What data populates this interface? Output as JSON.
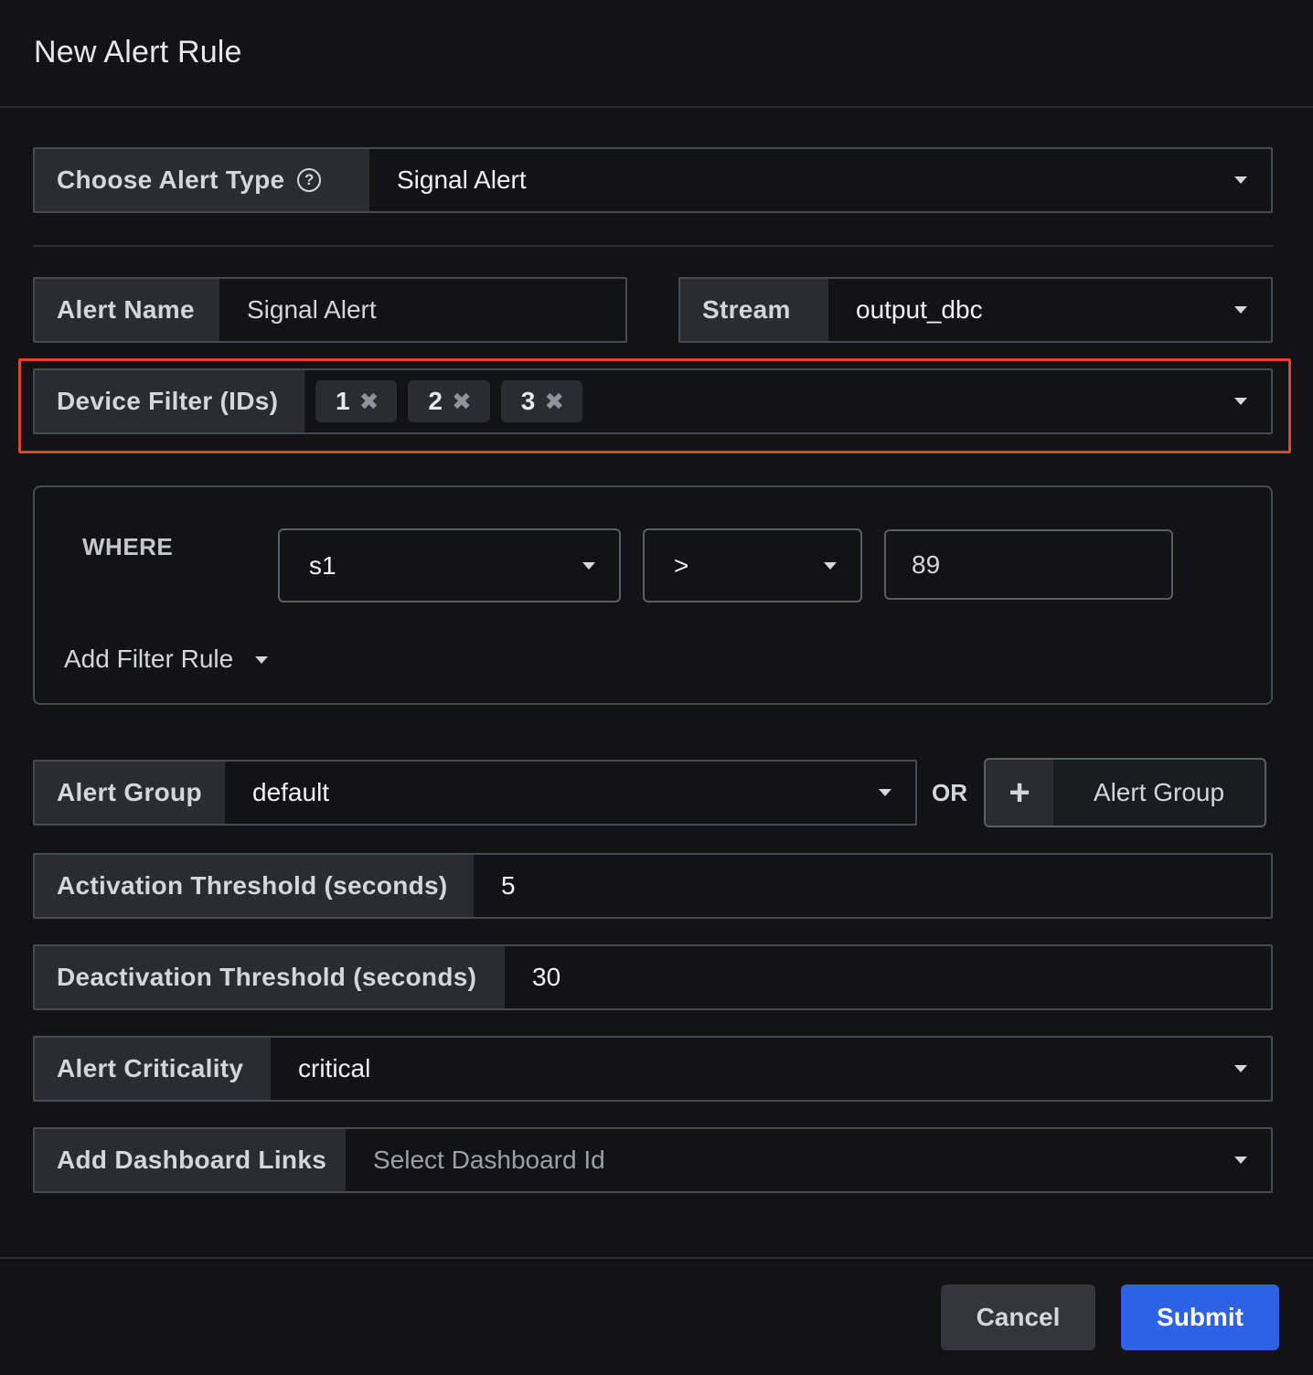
{
  "dialog": {
    "title": "New Alert Rule"
  },
  "alert_type": {
    "label": "Choose Alert Type",
    "value": "Signal Alert",
    "icon": "question-circle-icon"
  },
  "alert_name": {
    "label": "Alert Name",
    "value": "Signal Alert"
  },
  "stream": {
    "label": "Stream",
    "value": "output_dbc"
  },
  "device_filter": {
    "label": "Device Filter (IDs)",
    "chips": [
      "1",
      "2",
      "3"
    ],
    "remove_glyph": "✖"
  },
  "where": {
    "label": "WHERE",
    "signal": "s1",
    "operator": ">",
    "value": "89",
    "add_filter_label": "Add Filter Rule"
  },
  "alert_group": {
    "label": "Alert Group",
    "value": "default",
    "or_label": "OR",
    "add_button_plus": "+",
    "add_button_label": "Alert Group"
  },
  "activation": {
    "label": "Activation Threshold (seconds)",
    "value": "5"
  },
  "deactivation": {
    "label": "Deactivation Threshold (seconds)",
    "value": "30"
  },
  "criticality": {
    "label": "Alert Criticality",
    "value": "critical"
  },
  "dashboard_links": {
    "label": "Add Dashboard Links",
    "placeholder": "Select Dashboard Id"
  },
  "footer": {
    "cancel_label": "Cancel",
    "submit_label": "Submit"
  },
  "colors": {
    "highlight": "#e2432e",
    "primary": "#2d62e6",
    "background": "#131316"
  }
}
